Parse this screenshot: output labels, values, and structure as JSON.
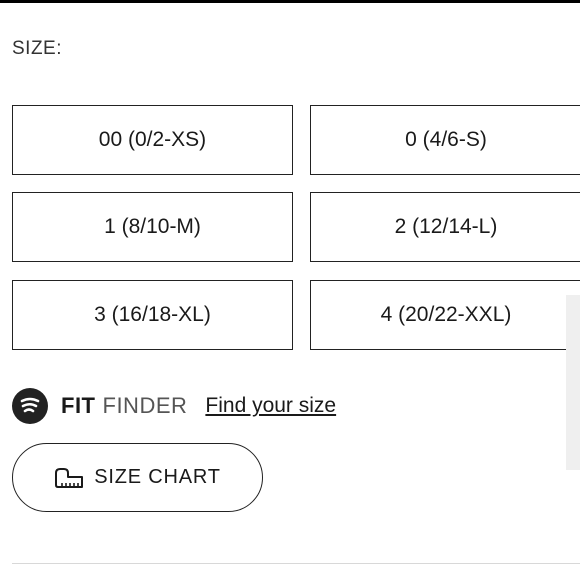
{
  "heading": "SIZE:",
  "sizes": [
    {
      "label": "00 (0/2-XS)"
    },
    {
      "label": "0 (4/6-S)"
    },
    {
      "label": "1 (8/10-M)"
    },
    {
      "label": "2 (12/14-L)"
    },
    {
      "label": "3 (16/18-XL)"
    },
    {
      "label": "4 (20/22-XXL)"
    }
  ],
  "fit_finder": {
    "brand_bold": "FIT",
    "brand_light": "FINDER",
    "link": "Find your size",
    "logo_icon": "fit-finder-logo-icon"
  },
  "size_chart": {
    "label": "SIZE CHART",
    "icon": "measuring-tape-icon"
  },
  "colors": {
    "text": "#1a1a1a",
    "border": "#222222",
    "background": "#ffffff"
  }
}
